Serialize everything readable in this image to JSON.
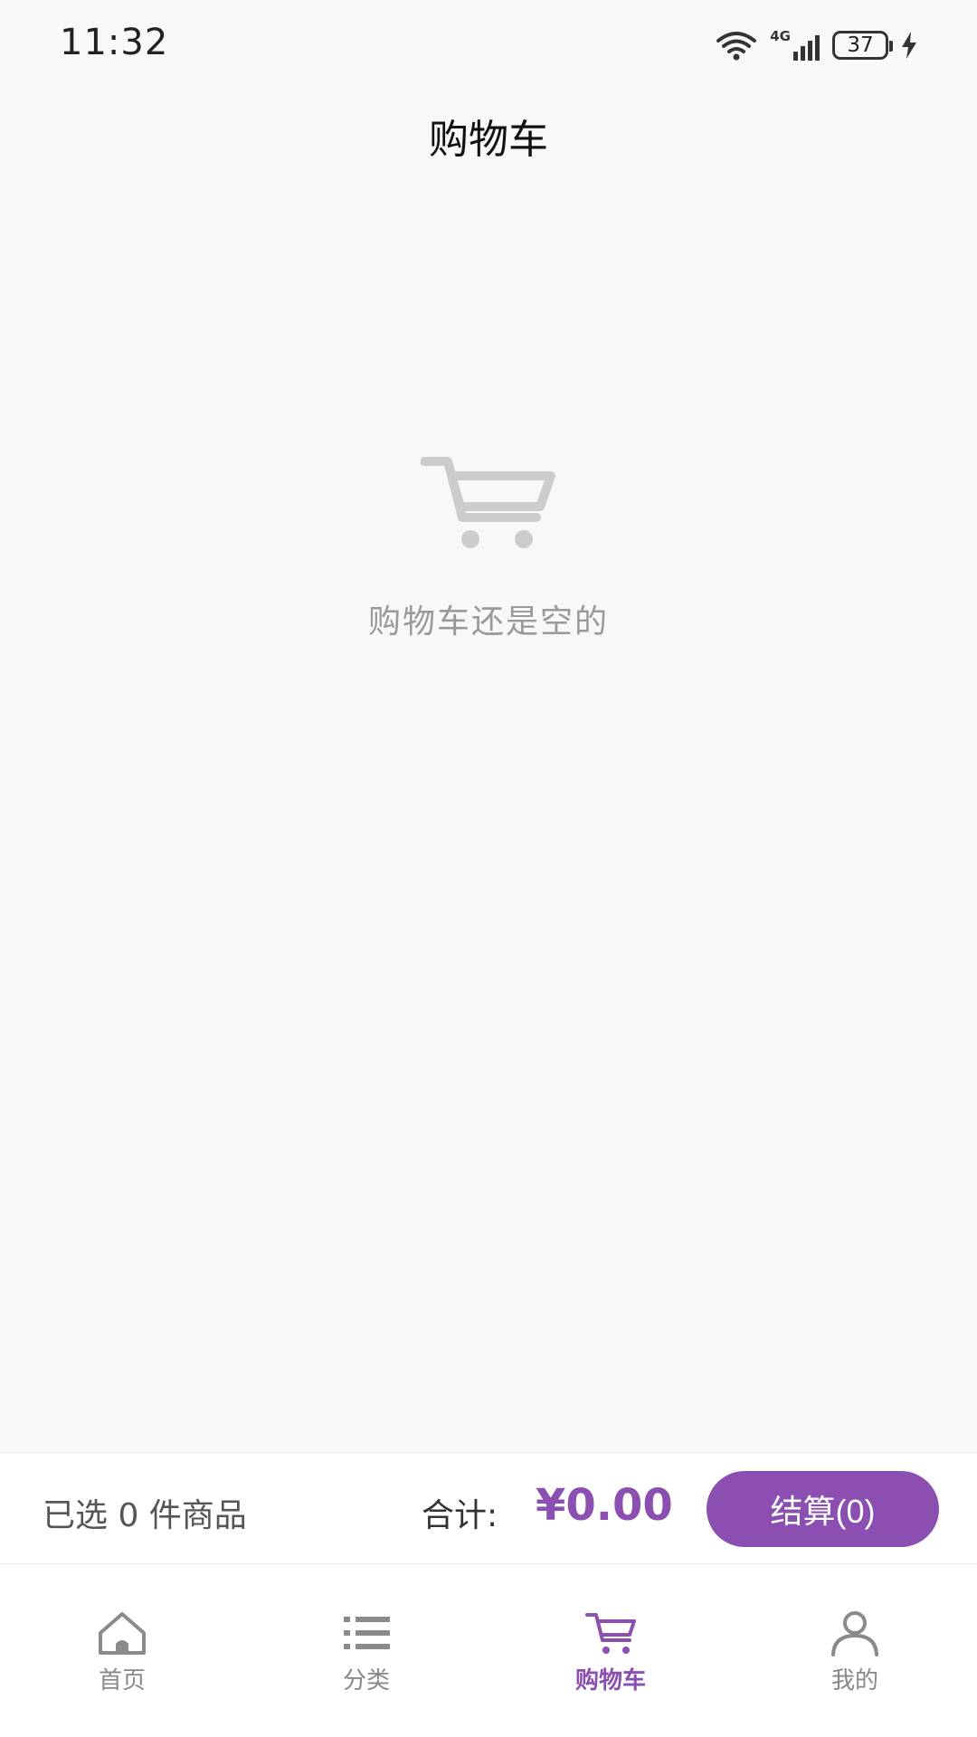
{
  "status_bar": {
    "time": "11:32",
    "network": "4G",
    "battery": "37"
  },
  "header": {
    "title": "购物车"
  },
  "empty_state": {
    "icon": "cart-icon",
    "message": "购物车还是空的"
  },
  "checkout_bar": {
    "selected_text": "已选 0 件商品",
    "total_label": "合计:",
    "total_amount": "¥0.00",
    "checkout_label": "结算(0)"
  },
  "bottom_nav": {
    "items": [
      {
        "label": "首页",
        "icon": "home-icon"
      },
      {
        "label": "分类",
        "icon": "list-icon"
      },
      {
        "label": "购物车",
        "icon": "cart-icon",
        "active": true
      },
      {
        "label": "我的",
        "icon": "user-icon"
      }
    ]
  },
  "colors": {
    "accent": "#8a4fb0",
    "background": "#f8f8f8",
    "muted_text": "#9a9a9a",
    "nav_inactive": "#888888"
  }
}
